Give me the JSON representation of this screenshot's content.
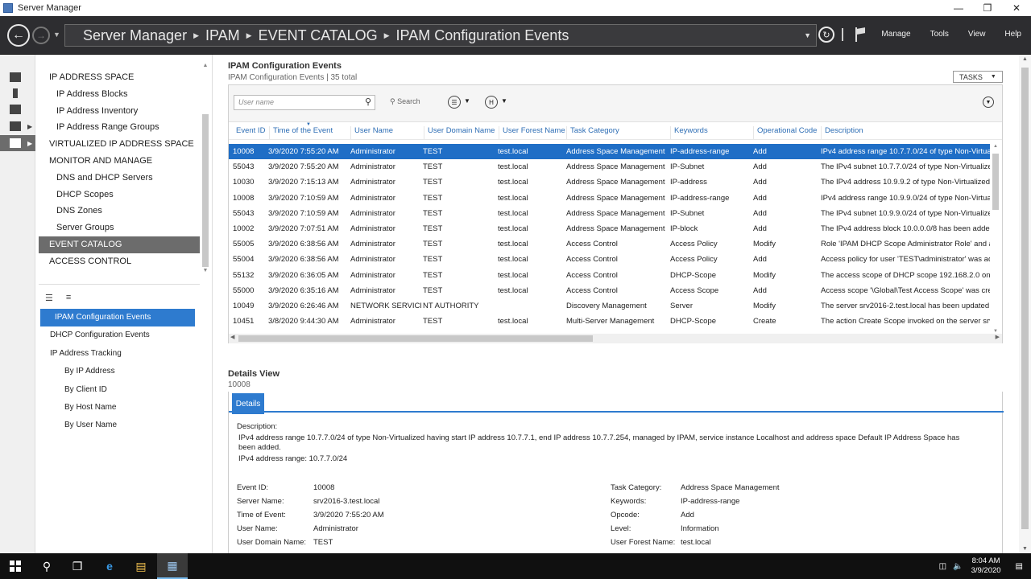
{
  "window": {
    "title": "Server Manager",
    "minimize": "—",
    "maximize": "❐",
    "close": "✕"
  },
  "header": {
    "crumbs": [
      "Server Manager",
      "IPAM",
      "EVENT CATALOG",
      "IPAM Configuration Events"
    ],
    "menus": [
      "Manage",
      "Tools",
      "View",
      "Help"
    ]
  },
  "tree": {
    "items": [
      {
        "label": "IP ADDRESS SPACE",
        "level": 0
      },
      {
        "label": "IP Address Blocks",
        "level": 1
      },
      {
        "label": "IP Address Inventory",
        "level": 1
      },
      {
        "label": "IP Address Range Groups",
        "level": 1
      },
      {
        "label": "VIRTUALIZED IP ADDRESS SPACE",
        "level": 0
      },
      {
        "label": "MONITOR AND MANAGE",
        "level": 0
      },
      {
        "label": "DNS and DHCP Servers",
        "level": 1
      },
      {
        "label": "DHCP Scopes",
        "level": 1
      },
      {
        "label": "DNS Zones",
        "level": 1
      },
      {
        "label": "Server Groups",
        "level": 1
      },
      {
        "label": "EVENT CATALOG",
        "level": 0,
        "selected": true
      },
      {
        "label": "ACCESS CONTROL",
        "level": 0
      }
    ],
    "bottom_items": [
      {
        "label": "IPAM Configuration Events",
        "level": 0,
        "selected": true
      },
      {
        "label": "DHCP Configuration Events",
        "level": 0
      },
      {
        "label": "IP Address Tracking",
        "level": 0
      },
      {
        "label": "By IP Address",
        "level": 1
      },
      {
        "label": "By Client ID",
        "level": 1
      },
      {
        "label": "By Host Name",
        "level": 1
      },
      {
        "label": "By User Name",
        "level": 1
      }
    ]
  },
  "events": {
    "title": "IPAM Configuration Events",
    "subtitle": "IPAM Configuration Events | 35 total",
    "tasks_label": "TASKS",
    "search_placeholder": "User name",
    "search_button": "Search",
    "columns": [
      "Event ID",
      "Time of the Event",
      "User Name",
      "User Domain Name",
      "User Forest Name",
      "Task Category",
      "Keywords",
      "Operational Code",
      "Description"
    ],
    "rows": [
      [
        "10008",
        "3/9/2020 7:55:20 AM",
        "Administrator",
        "TEST",
        "test.local",
        "Address Space Management",
        "IP-address-range",
        "Add",
        "IPv4 address range 10.7.7.0/24 of type Non-Virtualiz"
      ],
      [
        "55043",
        "3/9/2020 7:55:20 AM",
        "Administrator",
        "TEST",
        "test.local",
        "Address Space Management",
        "IP-Subnet",
        "Add",
        "The IPv4 subnet 10.7.7.0/24 of type Non-Virtualize"
      ],
      [
        "10030",
        "3/9/2020 7:15:13 AM",
        "Administrator",
        "TEST",
        "test.local",
        "Address Space Management",
        "IP-address",
        "Add",
        "The IPv4 address 10.9.9.2 of type Non-Virtualized I"
      ],
      [
        "10008",
        "3/9/2020 7:10:59 AM",
        "Administrator",
        "TEST",
        "test.local",
        "Address Space Management",
        "IP-address-range",
        "Add",
        "IPv4 address range 10.9.9.0/24 of type Non-Virtual"
      ],
      [
        "55043",
        "3/9/2020 7:10:59 AM",
        "Administrator",
        "TEST",
        "test.local",
        "Address Space Management",
        "IP-Subnet",
        "Add",
        "The IPv4 subnet 10.9.9.0/24 of type Non-Virtualize"
      ],
      [
        "10002",
        "3/9/2020 7:07:51 AM",
        "Administrator",
        "TEST",
        "test.local",
        "Address Space Management",
        "IP-block",
        "Add",
        "The IPv4 address block 10.0.0.0/8 has been added."
      ],
      [
        "55005",
        "3/9/2020 6:38:56 AM",
        "Administrator",
        "TEST",
        "test.local",
        "Access Control",
        "Access Policy",
        "Modify",
        "Role 'IPAM DHCP Scope Administrator Role' and a"
      ],
      [
        "55004",
        "3/9/2020 6:38:56 AM",
        "Administrator",
        "TEST",
        "test.local",
        "Access Control",
        "Access Policy",
        "Add",
        "Access policy for user 'TEST\\administrator' was ad"
      ],
      [
        "55132",
        "3/9/2020 6:36:05 AM",
        "Administrator",
        "TEST",
        "test.local",
        "Access Control",
        "DHCP-Scope",
        "Modify",
        "The access scope of DHCP scope 192.168.2.0 on se"
      ],
      [
        "55000",
        "3/9/2020 6:35:16 AM",
        "Administrator",
        "TEST",
        "test.local",
        "Access Control",
        "Access Scope",
        "Add",
        "Access scope '\\Global\\Test Access Scope' was crea"
      ],
      [
        "10049",
        "3/9/2020 6:26:46 AM",
        "NETWORK SERVICE",
        "NT AUTHORITY",
        "",
        "Discovery Management",
        "Server",
        "Modify",
        "The server srv2016-2.test.local has been updated v"
      ],
      [
        "10451",
        "3/8/2020 9:44:30 AM",
        "Administrator",
        "TEST",
        "test.local",
        "Multi-Server Management",
        "DHCP-Scope",
        "Create",
        "The action Create Scope invoked on the server srv"
      ]
    ]
  },
  "details": {
    "title": "Details View",
    "subtitle": "10008",
    "tab": "Details",
    "description_label": "Description:",
    "description_text": "IPv4 address range 10.7.7.0/24 of type Non-Virtualized having start IP address 10.7.7.1, end IP address 10.7.7.254, managed by IPAM, service instance Localhost and address space Default IP Address Space has been added.",
    "description_extra": "IPv4 address range: 10.7.7.0/24",
    "left": [
      {
        "k": "Event ID:",
        "v": "10008"
      },
      {
        "k": "Server Name:",
        "v": "srv2016-3.test.local"
      },
      {
        "k": "Time of Event:",
        "v": "3/9/2020 7:55:20 AM"
      },
      {
        "k": "User Name:",
        "v": "Administrator"
      },
      {
        "k": "User Domain Name:",
        "v": "TEST"
      }
    ],
    "right": [
      {
        "k": "Task Category:",
        "v": "Address Space Management"
      },
      {
        "k": "Keywords:",
        "v": "IP-address-range"
      },
      {
        "k": "Opcode:",
        "v": "Add"
      },
      {
        "k": "Level:",
        "v": "Information"
      },
      {
        "k": "User Forest Name:",
        "v": "test.local"
      }
    ]
  },
  "taskbar": {
    "time": "8:04 AM",
    "date": "3/9/2020"
  }
}
